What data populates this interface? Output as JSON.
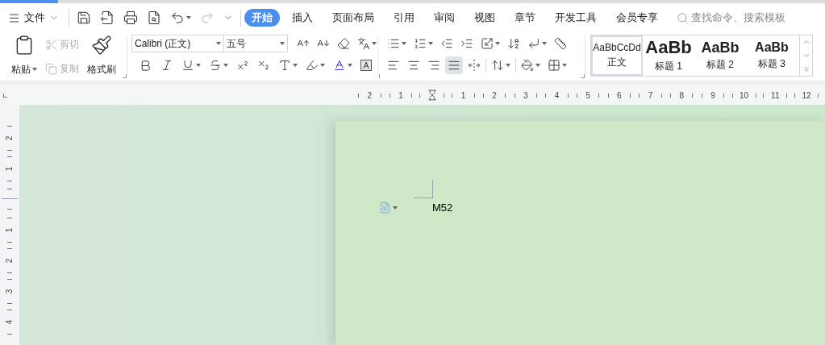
{
  "menu": {
    "label": "文件"
  },
  "quick_access": [
    {
      "kind": "save",
      "disabled": false
    },
    {
      "kind": "export",
      "disabled": false
    },
    {
      "kind": "print",
      "disabled": false
    },
    {
      "kind": "preview",
      "disabled": false
    },
    {
      "kind": "undo",
      "disabled": false
    },
    {
      "kind": "redo",
      "disabled": true
    },
    {
      "kind": "more",
      "disabled": false
    }
  ],
  "tabs": [
    {
      "label": "开始",
      "selected": true
    },
    {
      "label": "插入",
      "selected": false
    },
    {
      "label": "页面布局",
      "selected": false
    },
    {
      "label": "引用",
      "selected": false
    },
    {
      "label": "审阅",
      "selected": false
    },
    {
      "label": "视图",
      "selected": false
    },
    {
      "label": "章节",
      "selected": false
    },
    {
      "label": "开发工具",
      "selected": false
    },
    {
      "label": "会员专享",
      "selected": false
    }
  ],
  "search": {
    "placeholder": "查找命令、搜索模板"
  },
  "clipboard": {
    "paste": "粘贴",
    "cut": {
      "label": "剪切",
      "disabled": true
    },
    "copy": {
      "label": "复制",
      "disabled": true
    },
    "format_painter": "格式刷"
  },
  "font": {
    "name": "Calibri (正文)",
    "size": "五号"
  },
  "paragraph": {
    "alignment": [
      {
        "kind": "left",
        "selected": false
      },
      {
        "kind": "center",
        "selected": false
      },
      {
        "kind": "right",
        "selected": false
      },
      {
        "kind": "justify",
        "selected": true
      },
      {
        "kind": "distributed",
        "selected": false
      }
    ]
  },
  "styles": [
    {
      "kind": "body",
      "preview": "AaBbCcDd",
      "label": "正文",
      "selected": true
    },
    {
      "kind": "heading1",
      "preview": "AaBb",
      "label": "标题 1",
      "selected": false
    },
    {
      "kind": "heading2",
      "preview": "AaBb",
      "label": "标题 2",
      "selected": false
    },
    {
      "kind": "heading3",
      "preview": "AaBb",
      "label": "标题 3",
      "selected": false
    }
  ],
  "horizontal_ruler": {
    "before": [
      "2",
      "1"
    ],
    "after": [
      "1",
      "2",
      "3",
      "4",
      "5",
      "6",
      "7",
      "8",
      "9",
      "10",
      "11",
      "12"
    ]
  },
  "vertical_ruler": {
    "before": [
      "2",
      "1"
    ],
    "after": [
      "1",
      "2",
      "3",
      "4"
    ]
  },
  "document": {
    "text": "M52"
  }
}
